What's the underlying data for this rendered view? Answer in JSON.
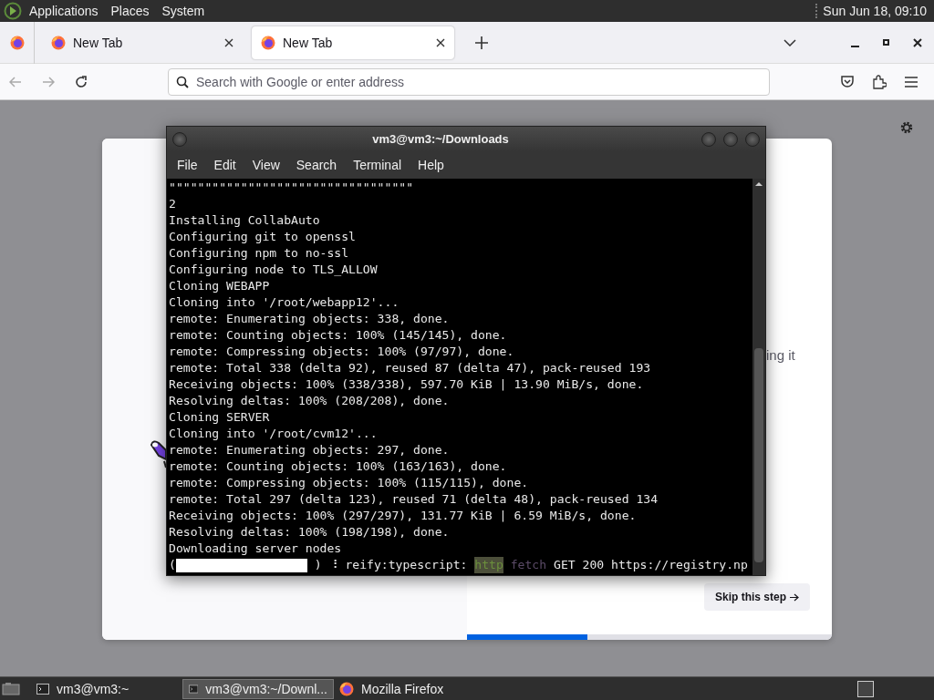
{
  "top_panel": {
    "menus": [
      "Applications",
      "Places",
      "System"
    ],
    "clock": "Sun Jun 18, 09:10"
  },
  "browser": {
    "tabs": [
      {
        "title": "New Tab",
        "selected": false
      },
      {
        "title": "New Tab",
        "selected": true
      }
    ],
    "address_placeholder": "Search with Google or enter address",
    "page": {
      "partial_text": "ing it",
      "skip_button": "Skip this step",
      "progress": {
        "level": 0.33
      }
    }
  },
  "terminal": {
    "title": "vm3@vm3:~/Downloads",
    "menus": [
      "File",
      "Edit",
      "View",
      "Search",
      "Terminal",
      "Help"
    ],
    "lines": [
      "\"\"\"\"\"\"\"\"\"\"\"\"\"\"\"\"\"\"\"\"\"\"\"\"\"\"\"\"\"\"\"\"\"\"",
      "2",
      "Installing CollabAuto",
      "Configuring git to openssl",
      "Configuring npm to no-ssl",
      "Configuring node to TLS_ALLOW",
      "Cloning WEBAPP",
      "Cloning into '/root/webapp12'...",
      "remote: Enumerating objects: 338, done.",
      "remote: Counting objects: 100% (145/145), done.",
      "remote: Compressing objects: 100% (97/97), done.",
      "remote: Total 338 (delta 92), reused 87 (delta 47), pack-reused 193",
      "Receiving objects: 100% (338/338), 597.70 KiB | 13.90 MiB/s, done.",
      "Resolving deltas: 100% (208/208), done.",
      "Cloning SERVER",
      "Cloning into '/root/cvm12'...",
      "remote: Enumerating objects: 297, done.",
      "remote: Counting objects: 100% (163/163), done.",
      "remote: Compressing objects: 100% (115/115), done.",
      "remote: Total 297 (delta 123), reused 71 (delta 48), pack-reused 134",
      "Receiving objects: 100% (297/297), 131.77 KiB | 6.59 MiB/s, done.",
      "Resolving deltas: 100% (198/198), done.",
      "Downloading server nodes"
    ],
    "status_line": [
      {
        "kind": "plain",
        "text": "("
      },
      {
        "kind": "gauge",
        "level": 1
      },
      {
        "kind": "plain",
        "text": ")"
      },
      {
        "kind": "plain",
        "text": "⠸"
      },
      {
        "kind": "plain",
        "text": "reify:typescript:"
      },
      {
        "kind": "tag",
        "text": "http"
      },
      {
        "kind": "dim",
        "text": "fetch"
      },
      {
        "kind": "plain",
        "text": "GET 200 https://registry.np"
      }
    ]
  },
  "taskbar": {
    "items": [
      {
        "kind": "terminal",
        "label": "vm3@vm3:~",
        "selected": false
      },
      {
        "kind": "terminal",
        "label": "vm3@vm3:~/Downl...",
        "selected": true
      },
      {
        "kind": "firefox",
        "label": "Mozilla Firefox",
        "selected": false
      }
    ]
  }
}
